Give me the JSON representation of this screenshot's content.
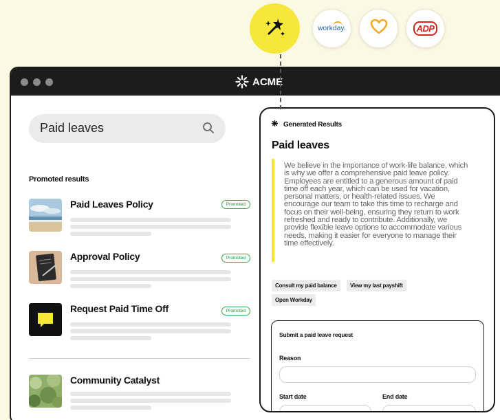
{
  "integrations": [
    {
      "name": "generate",
      "icon": "magic-wand-icon",
      "accent": "#f6e83a"
    },
    {
      "name": "workday",
      "label": "workday."
    },
    {
      "name": "benefits",
      "icon": "heart-icon",
      "accent": "#f5a623"
    },
    {
      "name": "adp",
      "label": "ADP",
      "accent": "#d0271d"
    }
  ],
  "app": {
    "brand": "ACME"
  },
  "search": {
    "query": "Paid leaves"
  },
  "promoted": {
    "heading": "Promoted results",
    "items": [
      {
        "title": "Paid Leaves Policy",
        "badge": "Promoted",
        "thumbnail": "beach-image"
      },
      {
        "title": "Approval Policy",
        "badge": "Promoted",
        "thumbnail": "notebook-image"
      },
      {
        "title": "Request Paid Time Off",
        "badge": "Promoted",
        "thumbnail": "chat-icon"
      }
    ]
  },
  "community": {
    "title": "Community Catalyst",
    "thumbnail": "grass-image"
  },
  "generated": {
    "heading": "Generated Results",
    "title": "Paid leaves",
    "body": "We believe in the importance of work-life balance, which is why we offer a comprehensive paid leave policy. Employees are entitled to a generous amount of paid time off each year, which can be used for vacation, personal matters, or health-related issues. We encourage our team to take this time to recharge and focus on their well-being, ensuring they return to work refreshed and ready to contribute. Additionally, we provide flexible leave options to accommodate various needs, making it easier for everyone to manage their time effectively.",
    "actions": [
      "Consult my paid balance",
      "View my last payshift",
      "Open Workday"
    ],
    "form": {
      "title": "Submit a paid leave request",
      "reason_label": "Reason",
      "start_label": "Start date",
      "end_label": "End date"
    }
  }
}
